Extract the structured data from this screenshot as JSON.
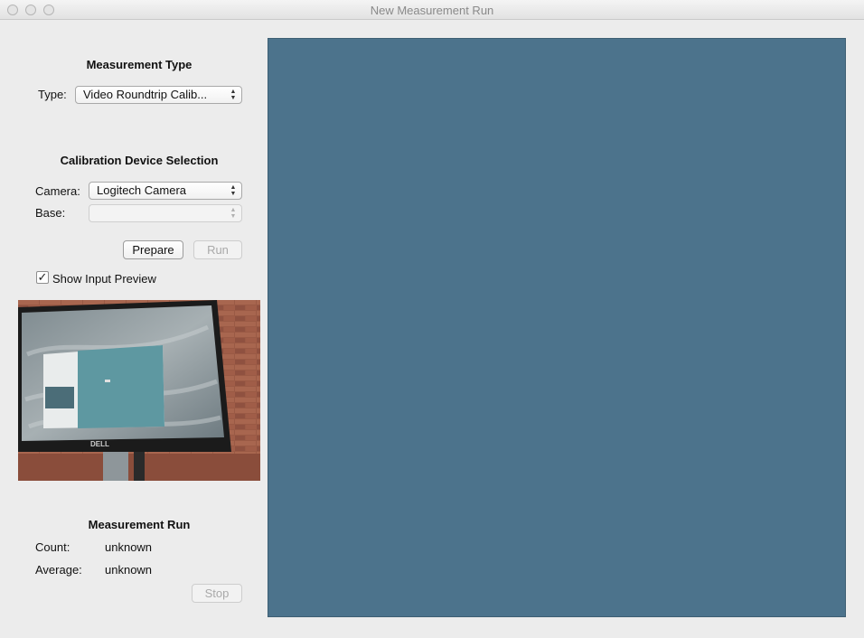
{
  "window": {
    "title": "New Measurement Run"
  },
  "measurement_type": {
    "heading": "Measurement Type",
    "type_label": "Type:",
    "type_value": "Video Roundtrip Calib..."
  },
  "calibration": {
    "heading": "Calibration Device Selection",
    "camera_label": "Camera:",
    "camera_value": "Logitech Camera",
    "base_label": "Base:",
    "base_value": ""
  },
  "buttons": {
    "prepare": "Prepare",
    "run": "Run",
    "stop": "Stop"
  },
  "preview": {
    "checkbox_label": "Show Input Preview",
    "checked": true,
    "screen_brand": "DELL"
  },
  "run": {
    "heading": "Measurement Run",
    "count_label": "Count:",
    "count_value": "unknown",
    "average_label": "Average:",
    "average_value": "unknown"
  },
  "colors": {
    "canvas": "#4c738c",
    "background": "#ececec"
  }
}
